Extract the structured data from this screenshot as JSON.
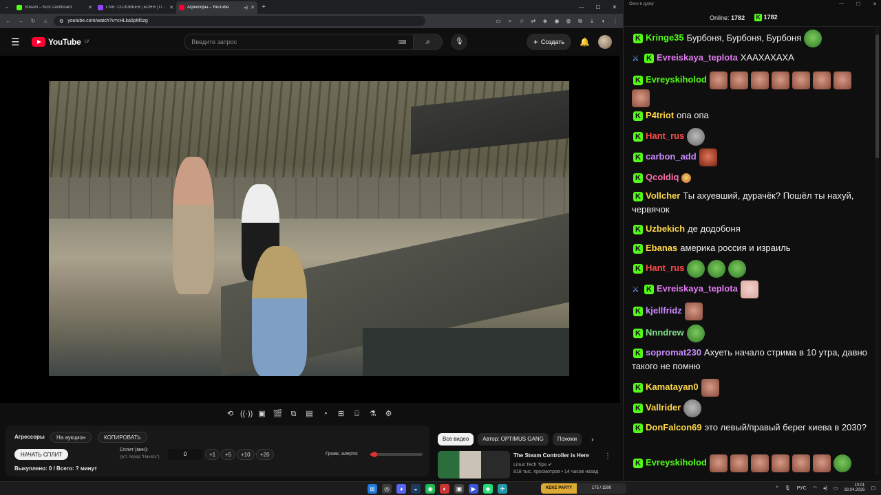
{
  "browser": {
    "tabs": [
      {
        "title": "Stream – Kick Dashboard",
        "color": "#53fc18",
        "active": false
      },
      {
        "title": "LIVE: СОЛОВЬЁВ | БОНЯ | ПОЛ",
        "color": "#9146ff",
        "active": false
      },
      {
        "title": "Агрессоры – YouTube",
        "color": "#ff0033",
        "active": true
      }
    ],
    "url": "youtube.com/watch?v=cHLka5pM5zg"
  },
  "youtube": {
    "logo_text": "YouTube",
    "region": "LV",
    "search_placeholder": "Введите запрос",
    "create_label": "Создать"
  },
  "extension": {
    "title": "Агрессоры",
    "auction_label": "На аукцион",
    "copy_label": "КОПИРОВАТЬ",
    "start_split_label": "НАЧАТЬ СПЛИТ",
    "split_label": "Сплит (мин):",
    "split_hint": "(уст. перед \"Начать\")",
    "split_value": "0",
    "increments": [
      "+1",
      "+5",
      "+10",
      "+20"
    ],
    "alert_volume_label": "Громк. алерта:",
    "alert_volume_fraction": 0.05,
    "stats": "Выкуплено: 0 / Всего: ? минут"
  },
  "recommendations": {
    "chips": [
      "Все видео",
      "Автор: OPTIMUS GANG",
      "Похожи"
    ],
    "item": {
      "title": "The Steam Controller is Here",
      "channel": "Linus Tech Tips",
      "meta": "818 тыс. просмотров • 14 часов назад"
    }
  },
  "chat": {
    "window_title": "Окно в дурку",
    "online_label": "Online:",
    "online_count": "1782",
    "viewer_count": "1782",
    "messages": [
      {
        "user": "Kringe35",
        "color": "#53fc18",
        "text": "Бурбоня, Бурбоня, Бурбоня",
        "emotes": [
          "pepe"
        ],
        "sword": false
      },
      {
        "user": "Evreiskaya_teplota",
        "color": "#e07bf0",
        "text": "ХААХАХАХА",
        "emotes": [],
        "sword": true
      },
      {
        "user": "Evreyskiholod",
        "color": "#53fc18",
        "text": "",
        "emotes": [
          "face",
          "face",
          "face",
          "face",
          "face",
          "face",
          "face",
          "face"
        ],
        "sword": false
      },
      {
        "user": "P4triot",
        "color": "#ffd84a",
        "text": "опа опа",
        "emotes": [],
        "sword": false
      },
      {
        "user": "Hant_rus",
        "color": "#ff4a4a",
        "text": "",
        "emotes": [
          "grey"
        ],
        "sword": false
      },
      {
        "user": "carbon_add",
        "color": "#c98bff",
        "text": "",
        "emotes": [
          "red"
        ],
        "sword": false
      },
      {
        "user": "Qcoldiq",
        "color": "#ff6fae",
        "text": "",
        "emotes": [
          "small"
        ],
        "sword": false
      },
      {
        "user": "Vollcher",
        "color": "#ffd84a",
        "text": "Ты ахуевший, дурачёк? Пошёл ты нахуй, червячок",
        "emotes": [],
        "sword": false
      },
      {
        "user": "Uzbekich",
        "color": "#ffd84a",
        "text": "де додобоня",
        "emotes": [],
        "sword": false
      },
      {
        "user": "Ebanas",
        "color": "#ffd84a",
        "text": "америка россия и израиль",
        "emotes": [],
        "sword": false
      },
      {
        "user": "Hant_rus",
        "color": "#ff4a4a",
        "text": "",
        "emotes": [
          "pepe",
          "pepe",
          "pepe"
        ],
        "sword": false
      },
      {
        "user": "Evreiskaya_teplota",
        "color": "#e07bf0",
        "text": "",
        "emotes": [
          "pink"
        ],
        "sword": true
      },
      {
        "user": "kjellfridz",
        "color": "#c98bff",
        "text": "",
        "emotes": [
          "face"
        ],
        "sword": false
      },
      {
        "user": "Nnndrew",
        "color": "#7fe08a",
        "text": "",
        "emotes": [
          "pepe"
        ],
        "sword": false
      },
      {
        "user": "sopromat230",
        "color": "#c98bff",
        "text": "Ахуеть начало стрима в 10 утра, давно такого не помню",
        "emotes": [],
        "sword": false
      },
      {
        "user": "Kamatayan0",
        "color": "#ffd84a",
        "text": "",
        "emotes": [
          "face"
        ],
        "sword": false
      },
      {
        "user": "Vallrider",
        "color": "#ffd84a",
        "text": "",
        "emotes": [
          "grey"
        ],
        "sword": false
      },
      {
        "user": "DonFalcon69",
        "color": "#ffd84a",
        "text": "это левый/правый берег киева в 2030?",
        "emotes": [],
        "sword": false
      },
      {
        "user": "Evreyskiholod",
        "color": "#53fc18",
        "text": "",
        "emotes": [
          "face",
          "face",
          "face",
          "face",
          "face",
          "face",
          "pepe"
        ],
        "sword": false
      }
    ]
  },
  "taskbar": {
    "app_label": "KEKE PARTY",
    "app_counter": "175 / 1500",
    "lang": "РУС",
    "time": "10:01",
    "date": "28.04.2026"
  }
}
